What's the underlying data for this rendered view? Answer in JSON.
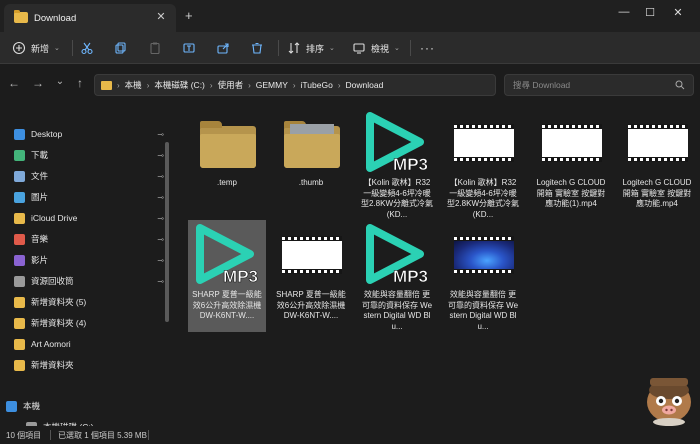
{
  "window": {
    "tab_title": "Download",
    "tab_close": "✕",
    "new_tab": "+",
    "minimize": "—",
    "maximize": "☐",
    "close": "✕"
  },
  "toolbar": {
    "new_label": "新增",
    "sort_label": "排序",
    "view_label": "檢視",
    "more": "···"
  },
  "nav": {
    "back": "←",
    "forward": "→",
    "recent": "⌄",
    "up": "↑",
    "breadcrumb": [
      "本機",
      "本機磁碟 (C:)",
      "使用者",
      "GEMMY",
      "iTubeGo",
      "Download"
    ],
    "search_placeholder": "搜尋 Download"
  },
  "sidebar": {
    "items": [
      {
        "label": "Desktop",
        "icon": "desktop-icon",
        "color": "#3d8fe0",
        "pinned": true
      },
      {
        "label": "下載",
        "icon": "download-icon",
        "color": "#43b47a",
        "pinned": true
      },
      {
        "label": "文件",
        "icon": "document-icon",
        "color": "#7fa9d9",
        "pinned": true
      },
      {
        "label": "圖片",
        "icon": "picture-icon",
        "color": "#4aa3df",
        "pinned": true
      },
      {
        "label": "iCloud Drive",
        "icon": "folder-icon",
        "color": "#e8b94a",
        "pinned": true
      },
      {
        "label": "音樂",
        "icon": "music-icon",
        "color": "#e05a4a",
        "pinned": true
      },
      {
        "label": "影片",
        "icon": "video-icon",
        "color": "#8a63d2",
        "pinned": true
      },
      {
        "label": "資源回收筒",
        "icon": "recycle-bin-icon",
        "color": "#9a9a9a",
        "pinned": true
      },
      {
        "label": "新增資料夾 (5)",
        "icon": "folder-icon",
        "color": "#e8b94a",
        "pinned": false
      },
      {
        "label": "新增資料夾 (4)",
        "icon": "folder-icon",
        "color": "#e8b94a",
        "pinned": false
      },
      {
        "label": "Art Aomori",
        "icon": "folder-icon",
        "color": "#e8b94a",
        "pinned": false
      },
      {
        "label": "新增資料夾",
        "icon": "folder-icon",
        "color": "#e8b94a",
        "pinned": false
      },
      {
        "label": "本機",
        "icon": "pc-icon",
        "color": "#3d8fe0",
        "pinned": false
      },
      {
        "label": "本機磁碟 (C:)",
        "icon": "drive-icon",
        "color": "#9a9a9a",
        "pinned": false
      }
    ],
    "pin_glyph": "📌"
  },
  "files": [
    {
      "name": ".temp",
      "kind": "folder"
    },
    {
      "name": ".thumb",
      "kind": "folder-photo"
    },
    {
      "name": "【Kolin 歌林】R32一級變頻4-6坪冷暖型2.8KW分離式冷氣(KD...",
      "kind": "mp3"
    },
    {
      "name": "【Kolin 歌林】R32一級變頻4-6坪冷暖型2.8KW分離式冷氣(KD...",
      "kind": "video"
    },
    {
      "name": "Logitech G CLOUD 開箱 實驗室 按鍵對應功能(1).mp4",
      "kind": "video"
    },
    {
      "name": "Logitech G CLOUD 開箱 實驗室 按鍵對應功能.mp4",
      "kind": "video"
    },
    {
      "name": "SHARP 夏普一級能效6公升高效除濕機 DW-K6NT-W....",
      "kind": "mp3",
      "selected": true
    },
    {
      "name": "SHARP 夏普一級能效6公升高效除濕機 DW-K6NT-W....",
      "kind": "video"
    },
    {
      "name": "效能與容量翻倍 更可靠的資料保存 Western Digital WD Blu...",
      "kind": "mp3"
    },
    {
      "name": "效能與容量翻倍 更可靠的資料保存 Western Digital WD Blu...",
      "kind": "video-win"
    }
  ],
  "mp3_badge": "MP3",
  "status": {
    "count": "10 個項目",
    "selected": "已選取 1 個項目 5.39 MB"
  },
  "colors": {
    "accent": "#2bd1b4",
    "folder": "#e8b94a",
    "selection": "#5a5a5a"
  }
}
